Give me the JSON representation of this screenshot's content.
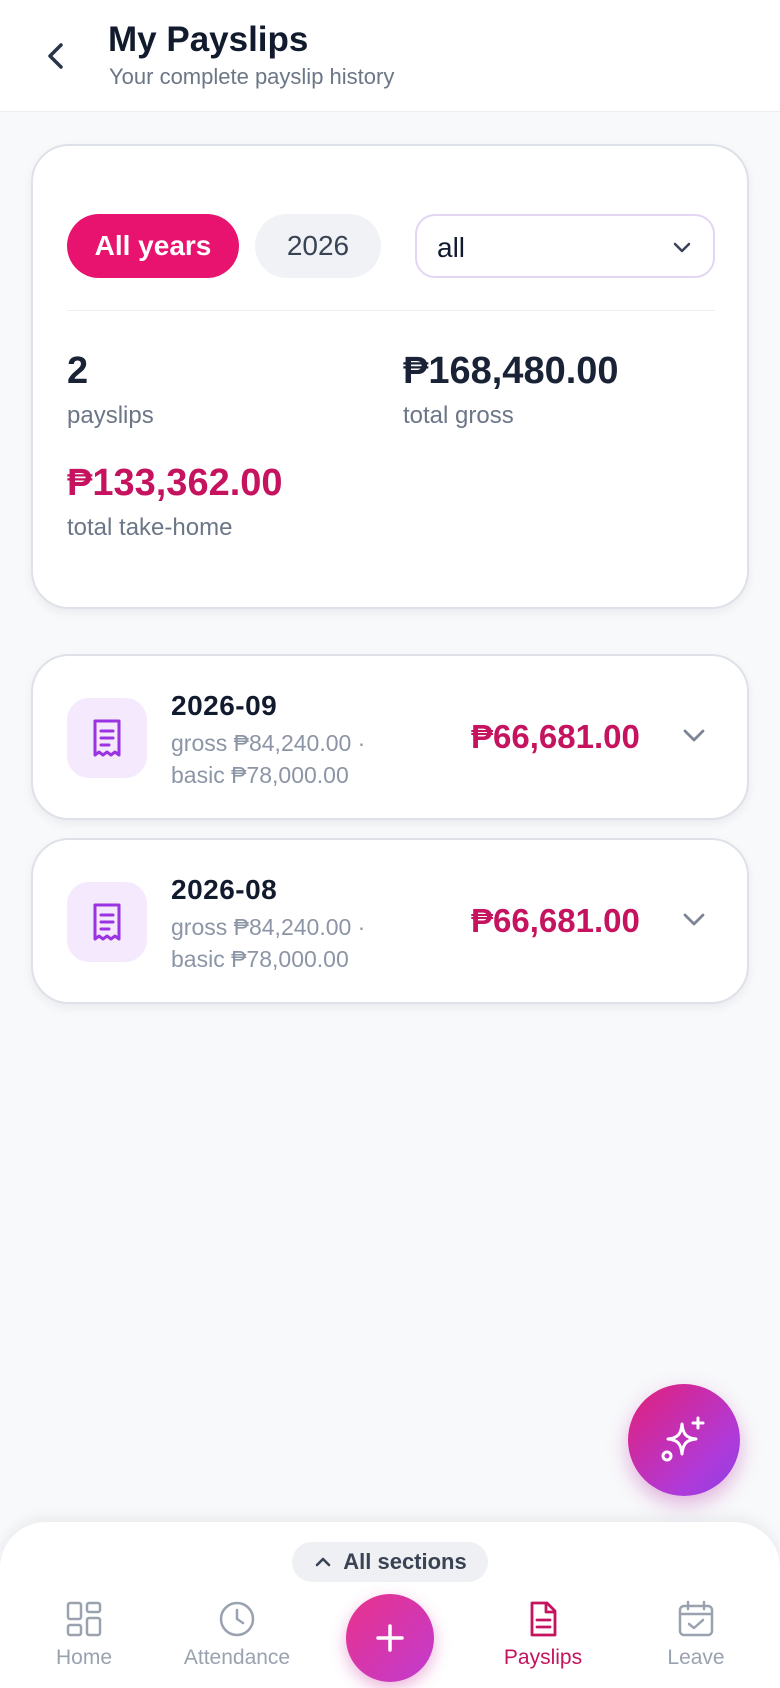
{
  "header": {
    "title": "My Payslips",
    "subtitle": "Your complete payslip history"
  },
  "filters": {
    "chips": [
      "All years",
      "2026"
    ],
    "selected_chip": "All years",
    "select_value": "all"
  },
  "summary": {
    "count": "2",
    "count_label": "payslips",
    "total_gross": "₱168,480.00",
    "total_gross_label": "total gross",
    "total_take_home": "₱133,362.00",
    "total_take_home_label": "total take-home"
  },
  "payslips": [
    {
      "period": "2026-09",
      "gross_line": "gross ₱84,240.00 ·",
      "basic_line": "basic ₱78,000.00",
      "net": "₱66,681.00"
    },
    {
      "period": "2026-08",
      "gross_line": "gross ₱84,240.00 ·",
      "basic_line": "basic ₱78,000.00",
      "net": "₱66,681.00"
    }
  ],
  "bottom_nav": {
    "sections_label": "All sections",
    "items": [
      {
        "label": "Home",
        "icon": "grid-icon"
      },
      {
        "label": "Attendance",
        "icon": "clock-icon"
      },
      {
        "label": "Payslips",
        "icon": "document-icon",
        "active": true
      },
      {
        "label": "Leave",
        "icon": "calendar-check-icon"
      }
    ]
  },
  "colors": {
    "accent": "#e8136f",
    "amount": "#c5135f",
    "icon_purple": "#9b34e0"
  }
}
